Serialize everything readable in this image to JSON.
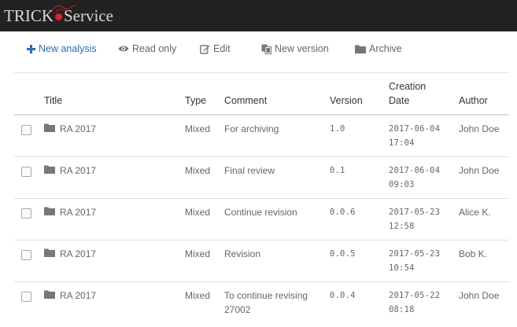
{
  "app": {
    "logo_left": "TRICK",
    "logo_right": "Service"
  },
  "toolbar": {
    "new_analysis": "New analysis",
    "read_only": "Read only",
    "edit": "Edit",
    "new_version": "New version",
    "archive": "Archive"
  },
  "table": {
    "headers": {
      "title": "Title",
      "type": "Type",
      "comment": "Comment",
      "version": "Version",
      "creation_line1": "Creation",
      "creation_line2": "Date",
      "author": "Author"
    },
    "rows": [
      {
        "title": "RA 2017",
        "type": "Mixed",
        "comment": "For archiving",
        "comment2": "",
        "version": "1.0",
        "date": "2017-06-04",
        "time": "17:04",
        "author": "John Doe"
      },
      {
        "title": "RA 2017",
        "type": "Mixed",
        "comment": "Final review",
        "comment2": "",
        "version": "0.1",
        "date": "2017-06-04",
        "time": "09:03",
        "author": "John Doe"
      },
      {
        "title": "RA 2017",
        "type": "Mixed",
        "comment": "Continue revision",
        "comment2": "",
        "version": "0.0.6",
        "date": "2017-05-23",
        "time": "12:58",
        "author": "Alice K."
      },
      {
        "title": "RA 2017",
        "type": "Mixed",
        "comment": "Revision",
        "comment2": "",
        "version": "0.0.5",
        "date": "2017-05-23",
        "time": "10:54",
        "author": "Bob K."
      },
      {
        "title": "RA 2017",
        "type": "Mixed",
        "comment": "To continue revising",
        "comment2": "27002",
        "version": "0.0.4",
        "date": "2017-05-22",
        "time": "08:18",
        "author": "John Doe"
      }
    ]
  },
  "colors": {
    "topbar": "#222222",
    "accent": "#2b6cb0",
    "logo_dot": "#e2202c"
  },
  "icons": {
    "new_analysis": "plus-icon",
    "read_only": "eye-icon",
    "edit": "edit-icon",
    "new_version": "copy-icon",
    "archive": "folder-icon",
    "row": "folder-icon"
  }
}
